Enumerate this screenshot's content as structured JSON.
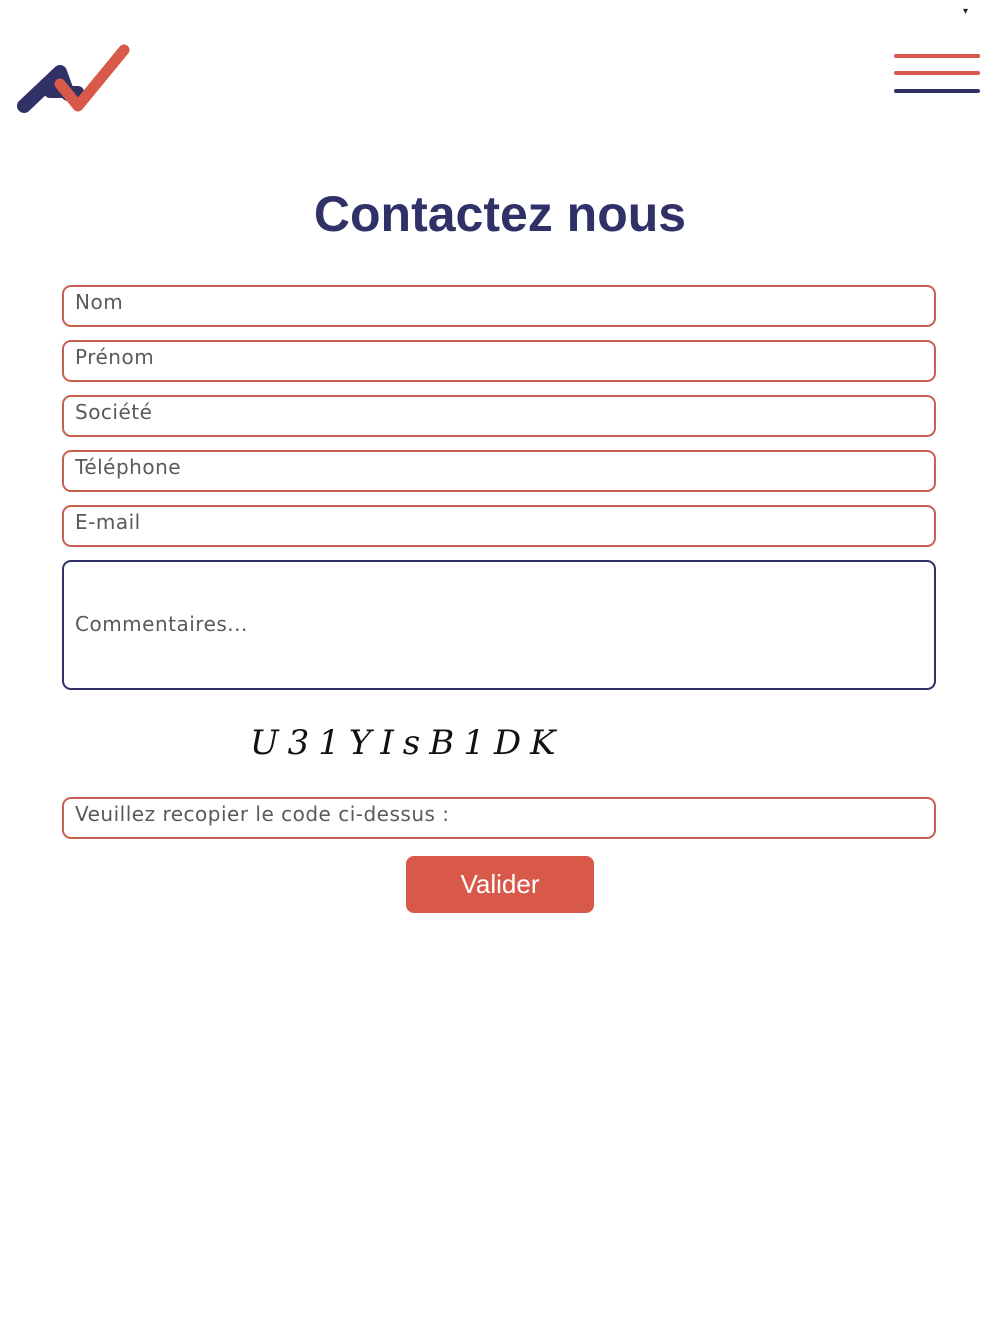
{
  "header": {
    "logo_icon": "brand-logo-icon",
    "menu_icon": "hamburger-menu-icon",
    "colors": {
      "navy": "#2f3167",
      "coral": "#d8594a"
    }
  },
  "page": {
    "title": "Contactez nous"
  },
  "form": {
    "fields": {
      "nom": {
        "placeholder": "Nom",
        "value": ""
      },
      "prenom": {
        "placeholder": "Prénom",
        "value": ""
      },
      "societe": {
        "placeholder": "Société",
        "value": ""
      },
      "telephone": {
        "placeholder": "Téléphone",
        "value": ""
      },
      "email": {
        "placeholder": "E-mail",
        "value": ""
      },
      "commentaires": {
        "placeholder": "Commentaires...",
        "value": ""
      }
    },
    "captcha": {
      "code": "U31YIsB1DK",
      "input_placeholder": "Veuillez recopier le code ci-dessus :",
      "input_value": ""
    },
    "submit_label": "Valider"
  }
}
